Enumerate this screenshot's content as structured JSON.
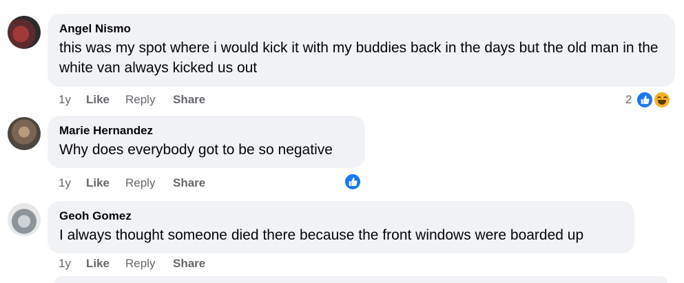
{
  "comments": [
    {
      "author": "Angel Nismo",
      "text": "this was my spot where i would kick it with my buddies back in the days but the old man in the white van always kicked us out",
      "time": "1y",
      "like": "Like",
      "reply": "Reply",
      "share": "Share",
      "reaction_count": "2",
      "reactions": [
        "like-icon",
        "haha-icon"
      ]
    },
    {
      "author": "Marie Hernandez",
      "text": "Why does everybody got to be so negative",
      "time": "1y",
      "like": "Like",
      "reply": "Reply",
      "share": "Share",
      "reactions": [
        "like-icon"
      ]
    },
    {
      "author": "Geoh Gomez",
      "text": "I always thought someone died there because the front windows were boarded up",
      "time": "1y",
      "like": "Like",
      "reply": "Reply",
      "share": "Share"
    }
  ],
  "colors": {
    "bubble": "#f0f2f5",
    "meta_text": "#65676b",
    "like_blue": "#1877f2",
    "haha_yellow": "#f7b125"
  }
}
